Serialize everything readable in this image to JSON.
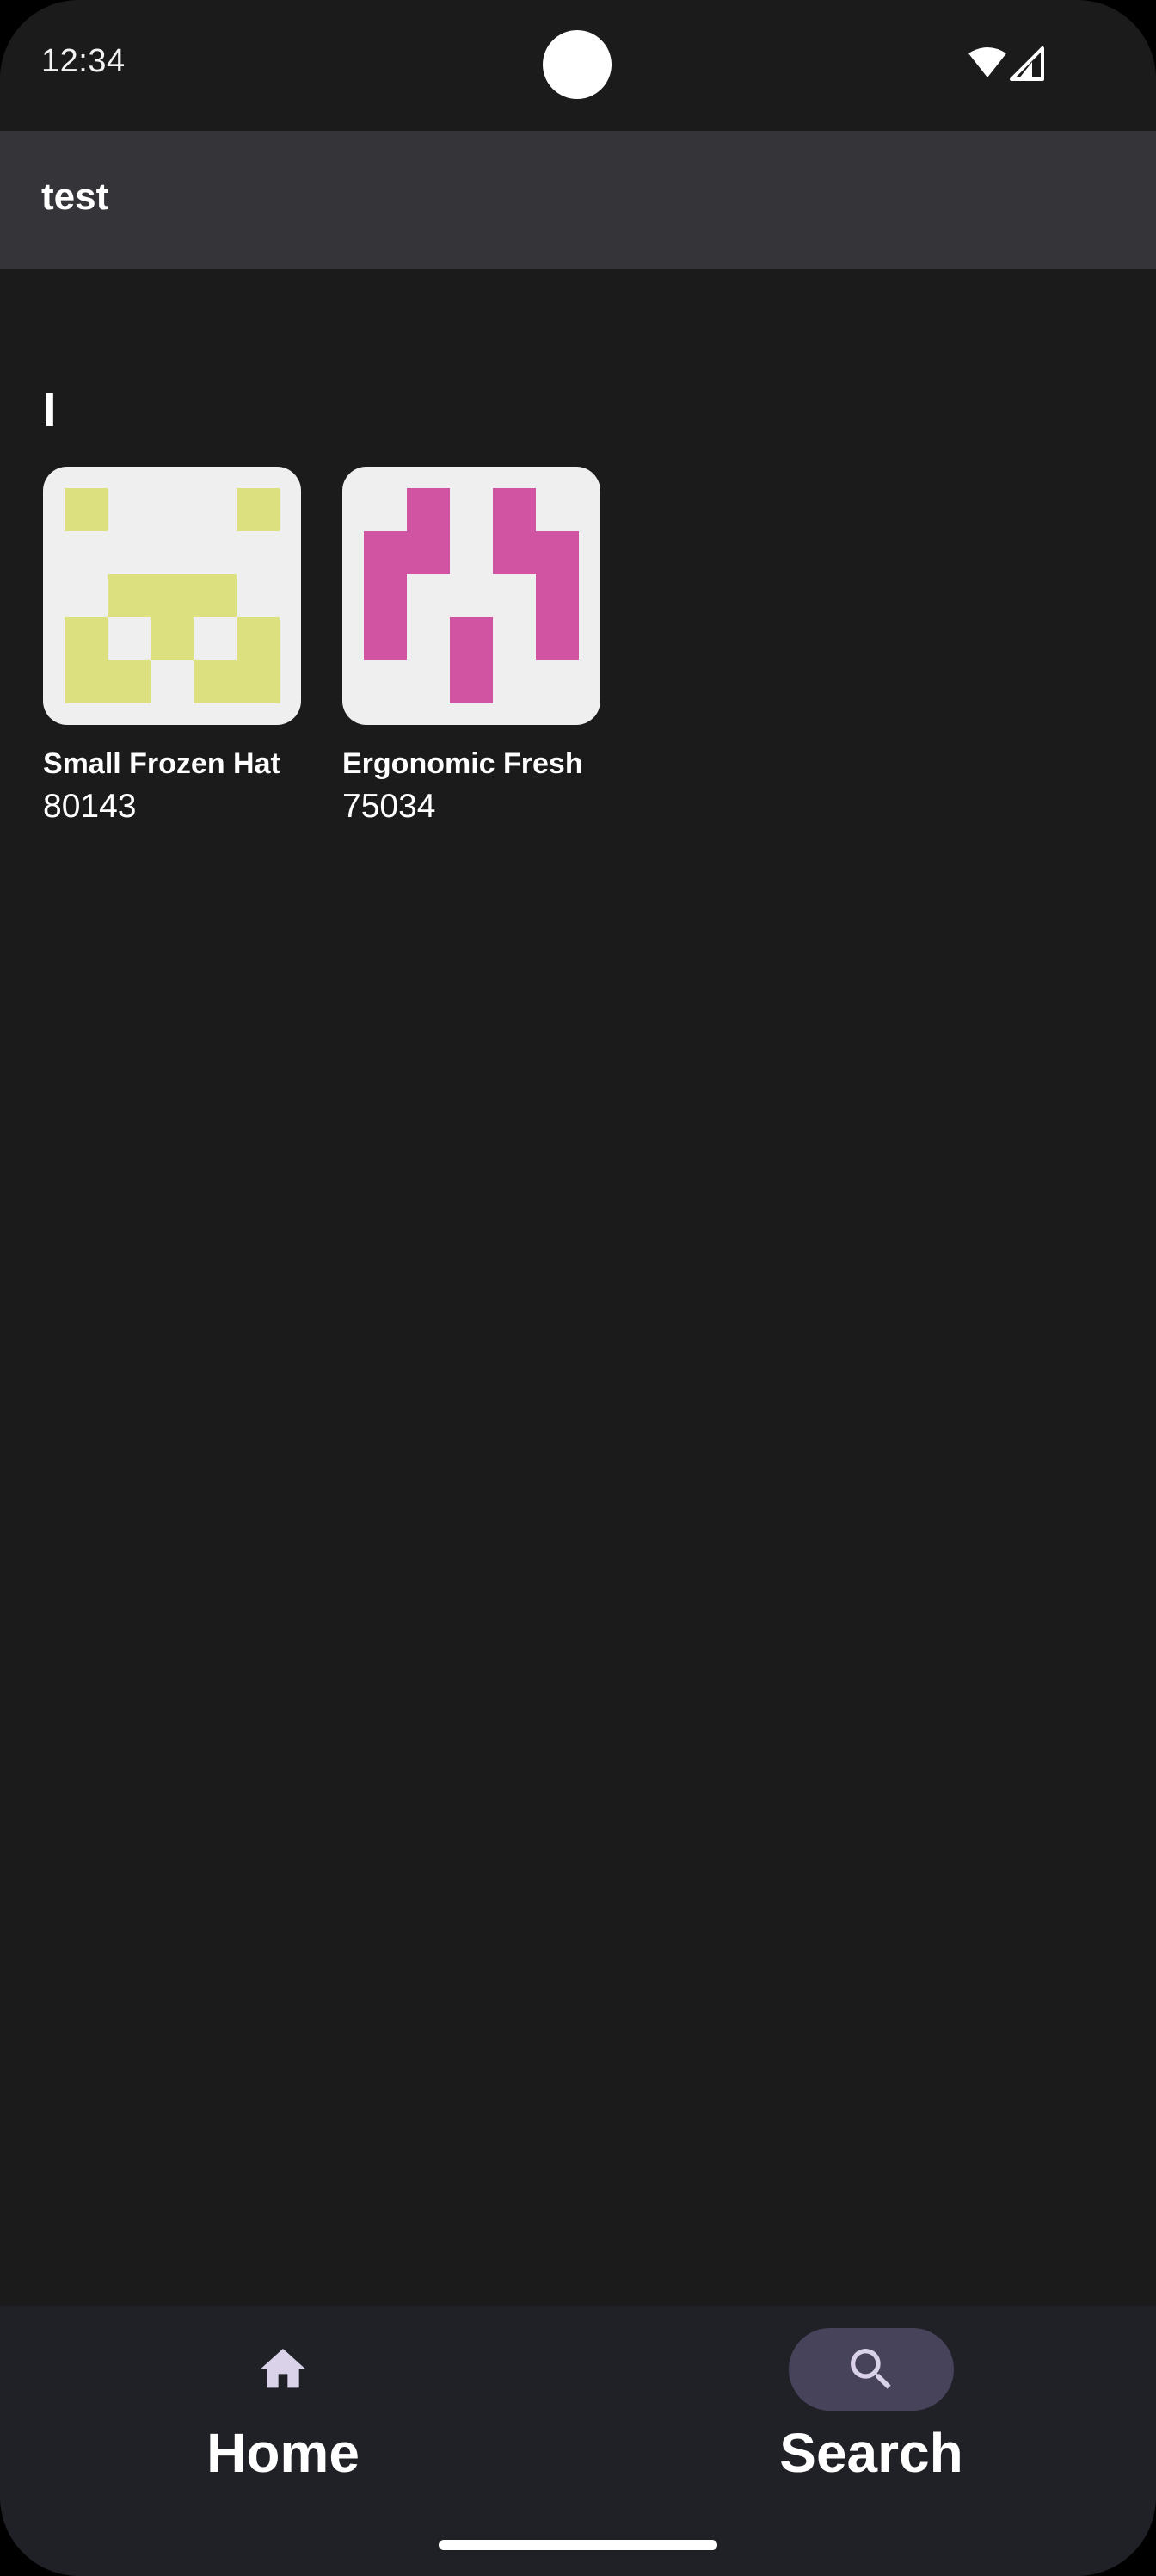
{
  "status_bar": {
    "time": "12:34",
    "icons": [
      "wifi-icon",
      "signal-icon"
    ]
  },
  "app_bar": {
    "title": "test"
  },
  "section": {
    "heading": "I"
  },
  "items": [
    {
      "name": "Small Frozen Hat",
      "number": "80143",
      "image_color": "#dde07f",
      "image_background": "#efefef"
    },
    {
      "name": "Ergonomic Fresh",
      "number": "75034",
      "image_color": "#d054a1",
      "image_background": "#efefef"
    }
  ],
  "bottom_nav": {
    "items": [
      {
        "label": "Home",
        "icon": "home-icon",
        "selected": false
      },
      {
        "label": "Search",
        "icon": "search-icon",
        "selected": true
      }
    ]
  },
  "colors": {
    "background": "#1b1b1c",
    "app_bar": "#343439",
    "bottom_nav": "#202027",
    "nav_indicator": "#47435a",
    "nav_icon": "#d9d2e8"
  }
}
